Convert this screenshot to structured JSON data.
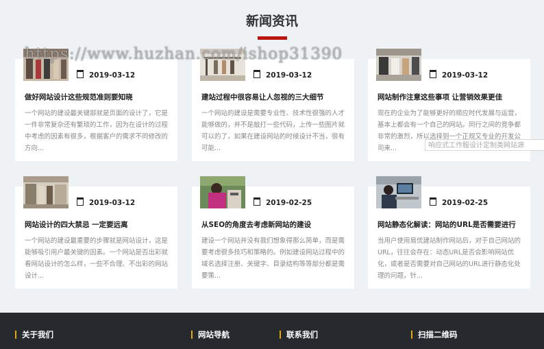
{
  "section_title": "新闻资讯",
  "watermark": "https://www.huzhan.com/ishop31390",
  "tooltip": "响应式工作服设计定制类网站源",
  "news": [
    {
      "date": "2019-03-12",
      "title": "做好网站设计这些规范准则要知晓",
      "excerpt": "一个网站的建设最关键部就是页面的设计了，它是一件非常复杂还有繁琐的工作，因为在设计的过程中考虑的因素有很多，根据客户的需求不同修改的方向..."
    },
    {
      "date": "2019-03-12",
      "title": "建站过程中很容易让人忽视的三大细节",
      "excerpt": "一个网站的建设是需要专业性、技术性很强的人才能够做的，并不是敲打一些代码，上传一些图片就可以的了，如果在建设网站的时候设计不当，很有可能..."
    },
    {
      "date": "2019-03-12",
      "title": "网站制作注意这些事项 让营销效果更佳",
      "excerpt": "现在的企业为了能够更好的顺应时代发展与运营，基本上都会有一个自己的网站。同行之间的竞争都非常的激烈，所以选择到一个正规又专业的开发公司来..."
    },
    {
      "date": "2019-03-12",
      "title": "网站设计的四大禁忌 一定要远离",
      "excerpt": "一个网站的建设最重要的步骤就是网站设计，这是能够吸引用户最关键的因素。一个网站是否出彩就看网站设计的怎么样，一些不合理、不出彩的网站设计..."
    },
    {
      "date": "2019-02-25",
      "title": "从SEO的角度去考虑新网站的建设",
      "excerpt": "建设一个网站并没有我们想象得那么简单，而是需要考虑很多技巧和策略的。例如建设网站过程中的域名选择注册、关键字、目录结构等等部分都是需要策..."
    },
    {
      "date": "2019-02-25",
      "title": "网站静态化解读：网站的URL是否需要进行",
      "excerpt": "当用户使用易优建站制作网站后，对于自己网站的URL，往往会存在：动态URL是否会影响网站优化，或者是否需要对自己网站的URL进行静态化处理的问题，针..."
    }
  ],
  "footer": {
    "about": "关于我们",
    "nav": "网站导航",
    "contact": "联系我们",
    "qrcode": "扫描二维码"
  },
  "colors": {
    "accent": "#b8160f",
    "footer_bg": "#262a2f",
    "footer_marker": "#e3a810",
    "page_bg": "#eef2f5"
  }
}
